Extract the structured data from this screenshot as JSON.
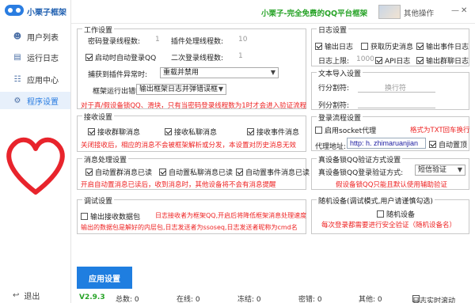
{
  "app": {
    "title": "小栗子框架"
  },
  "sidebar": {
    "items": [
      {
        "label": "用户列表",
        "icon": "user-icon"
      },
      {
        "label": "运行日志",
        "icon": "log-icon"
      },
      {
        "label": "应用中心",
        "icon": "app-center-icon"
      },
      {
        "label": "程序设置",
        "icon": "settings-icon"
      }
    ],
    "logout": "退出"
  },
  "topbar": {
    "slogan": "小栗子-完全免费的QQ平台框架",
    "other_ops": "其他操作"
  },
  "work": {
    "title": "工作设置",
    "pwd_login_threads_label": "密码登录线程数:",
    "pwd_login_threads_value": "1",
    "plugin_threads_label": "插件处理线程数:",
    "plugin_threads_value": "10",
    "auto_login_label": "启动时自动登录QQ",
    "second_login_label": "二次登录线程数:",
    "second_login_value": "1",
    "catch_exception_label": "捕获到插件异常时:",
    "catch_exception_value": "重载并禁用",
    "framework_error_label": "框架运行出错时:",
    "framework_error_value": "输出框架日志并弹错误框",
    "note": "对于真/假设备锁QQ、滑块，只有当密码登录线程数为1时才会进入验证流程"
  },
  "receive": {
    "title": "接收设置",
    "group_msg": "接收群聊消息",
    "private_msg": "接收私聊消息",
    "event_msg": "接收事件消息",
    "note": "关闭接收后，相应的消息不会被框架解析或分发，本设置对历史消息无效"
  },
  "msgproc": {
    "title": "消息处理设置",
    "auto_group_read": "自动置群消息已读",
    "auto_private_read": "自动置私聊消息已读",
    "auto_event_read": "自动置事件消息已读",
    "note": "开启自动置消息已读后，收到消息时，其他设备将不会有消息提醒"
  },
  "debug": {
    "title": "调试设置",
    "output_packets": "输出接收数据包",
    "note_line1": "日志接收者为框架QQ,开启后将降低框架消息处理速度",
    "note_line2": "输出的数据包是解好的内层包,日志发送者为ssoseq,日志发送者昵称为cmd名"
  },
  "logset": {
    "title": "日志设置",
    "output_log": "输出日志",
    "fetch_history": "获取历史消息",
    "output_event_log": "输出事件日志",
    "limit_label": "日志上限:",
    "limit_value": "1000",
    "api_log": "API日志",
    "output_group_log": "输出群聊日志"
  },
  "textinput": {
    "title": "文本导入设置",
    "line_sep_label": "行分割符:",
    "line_sep_value": "换行符",
    "col_sep_label": "列分割符:"
  },
  "loginflow": {
    "title": "登录流程设置",
    "socket_proxy": "启用socket代理",
    "format_note": "格式为TXT回车换行",
    "proxy_label": "代理地址:",
    "proxy_value": "http: h. zhimaruanjian",
    "auto_pin": "自动置顶"
  },
  "devlock": {
    "title": "真设备锁QQ验证方式设置",
    "method_label": "真设备锁QQ登录验证方式:",
    "method_value": "短信验证",
    "note": "假设备锁QQ只能且默认使用辅助验证"
  },
  "randdev": {
    "title": "随机设备(调试模式,用户请谨慎勾选)",
    "random_device": "随机设备",
    "note": "每次登录都需要进行安全验证（随机设备名）"
  },
  "buttons": {
    "apply": "应用设置"
  },
  "status": {
    "version": "V2.9.3",
    "total": "总数: 0",
    "online": "在线: 0",
    "frozen": "冻结: 0",
    "password": "密错: 0",
    "other": "其他: 0",
    "log_scroll": "日志实时滚动"
  }
}
